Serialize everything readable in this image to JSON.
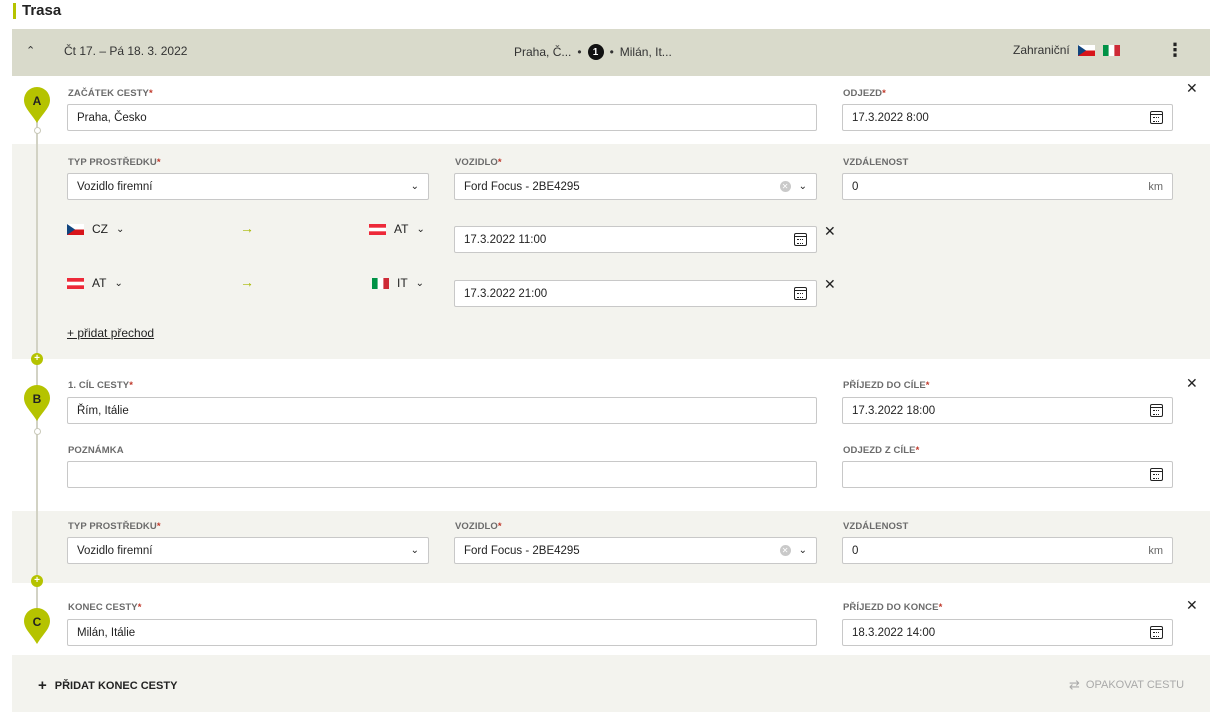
{
  "section_title": "Trasa",
  "header": {
    "dates": "Čt 17. – Pá 18. 3. 2022",
    "route_from": "Praha, Č...",
    "route_count": "1",
    "route_to": "Milán, It...",
    "trip_type": "Zahraniční"
  },
  "start": {
    "pin": "A",
    "place_label": "ZAČÁTEK CESTY",
    "place_value": "Praha, Česko",
    "time_label": "ODJEZD",
    "time_value": "17.3.2022 8:00"
  },
  "leg1": {
    "transport_label": "TYP PROSTŘEDKU",
    "transport_value": "Vozidlo firemní",
    "vehicle_label": "VOZIDLO",
    "vehicle_value": "Ford Focus - 2BE4295",
    "distance_label": "VZDÁLENOST",
    "distance_value": "0",
    "distance_unit": "km",
    "crossings": [
      {
        "from": "CZ",
        "to": "AT",
        "datetime": "17.3.2022 11:00"
      },
      {
        "from": "AT",
        "to": "IT",
        "datetime": "17.3.2022 21:00"
      }
    ],
    "add_crossing": "+ přidat přechod"
  },
  "destination": {
    "pin": "B",
    "place_label": "1. CÍL CESTY",
    "place_value": "Řím, Itálie",
    "arrival_label": "PŘÍJEZD DO CÍLE",
    "arrival_value": "17.3.2022 18:00",
    "note_label": "POZNÁMKA",
    "note_value": "",
    "departure_label": "ODJEZD Z CÍLE",
    "departure_value": ""
  },
  "leg2": {
    "transport_label": "TYP PROSTŘEDKU",
    "transport_value": "Vozidlo firemní",
    "vehicle_label": "VOZIDLO",
    "vehicle_value": "Ford Focus - 2BE4295",
    "distance_label": "VZDÁLENOST",
    "distance_value": "0",
    "distance_unit": "km"
  },
  "end": {
    "pin": "C",
    "place_label": "KONEC CESTY",
    "place_value": "Milán, Itálie",
    "arrival_label": "PŘÍJEZD DO KONCE",
    "arrival_value": "18.3.2022 14:00"
  },
  "footer": {
    "add_end": "PŘIDAT KONEC CESTY",
    "repeat": "OPAKOVAT CESTU"
  },
  "colors": {
    "accent": "#b5c300",
    "header_bg": "#d9dacb",
    "section_bg": "#f3f3ee",
    "required": "#c0392b"
  },
  "icons": [
    "chevron-up-icon",
    "kebab-menu-icon",
    "calendar-icon",
    "close-icon",
    "arrow-right-icon",
    "clear-icon",
    "map-pin-icon",
    "plus-icon",
    "repeat-icon",
    "flag-cz-icon",
    "flag-at-icon",
    "flag-it-icon"
  ]
}
